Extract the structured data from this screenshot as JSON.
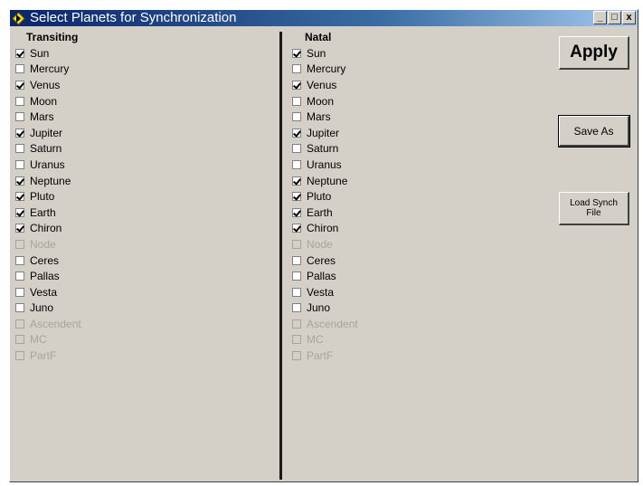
{
  "window": {
    "title": "Select Planets for Synchronization",
    "minimize_glyph": "_",
    "maximize_glyph": "□",
    "close_glyph": "x"
  },
  "transiting": {
    "header": "Transiting",
    "items": [
      {
        "label": "Sun",
        "checked": true,
        "enabled": true
      },
      {
        "label": "Mercury",
        "checked": false,
        "enabled": true
      },
      {
        "label": "Venus",
        "checked": true,
        "enabled": true
      },
      {
        "label": "Moon",
        "checked": false,
        "enabled": true
      },
      {
        "label": "Mars",
        "checked": false,
        "enabled": true
      },
      {
        "label": "Jupiter",
        "checked": true,
        "enabled": true
      },
      {
        "label": "Saturn",
        "checked": false,
        "enabled": true
      },
      {
        "label": "Uranus",
        "checked": false,
        "enabled": true
      },
      {
        "label": "Neptune",
        "checked": true,
        "enabled": true
      },
      {
        "label": "Pluto",
        "checked": true,
        "enabled": true
      },
      {
        "label": "Earth",
        "checked": true,
        "enabled": true
      },
      {
        "label": "Chiron",
        "checked": true,
        "enabled": true
      },
      {
        "label": "Node",
        "checked": false,
        "enabled": false
      },
      {
        "label": "Ceres",
        "checked": false,
        "enabled": true
      },
      {
        "label": "Pallas",
        "checked": false,
        "enabled": true
      },
      {
        "label": "Vesta",
        "checked": false,
        "enabled": true
      },
      {
        "label": "Juno",
        "checked": false,
        "enabled": true
      },
      {
        "label": "Ascendent",
        "checked": false,
        "enabled": false
      },
      {
        "label": "MC",
        "checked": false,
        "enabled": false
      },
      {
        "label": "PartF",
        "checked": false,
        "enabled": false
      }
    ]
  },
  "natal": {
    "header": "Natal",
    "items": [
      {
        "label": "Sun",
        "checked": true,
        "enabled": true
      },
      {
        "label": "Mercury",
        "checked": false,
        "enabled": true
      },
      {
        "label": "Venus",
        "checked": true,
        "enabled": true
      },
      {
        "label": "Moon",
        "checked": false,
        "enabled": true
      },
      {
        "label": "Mars",
        "checked": false,
        "enabled": true
      },
      {
        "label": "Jupiter",
        "checked": true,
        "enabled": true
      },
      {
        "label": "Saturn",
        "checked": false,
        "enabled": true
      },
      {
        "label": "Uranus",
        "checked": false,
        "enabled": true
      },
      {
        "label": "Neptune",
        "checked": true,
        "enabled": true
      },
      {
        "label": "Pluto",
        "checked": true,
        "enabled": true
      },
      {
        "label": "Earth",
        "checked": true,
        "enabled": true
      },
      {
        "label": "Chiron",
        "checked": true,
        "enabled": true
      },
      {
        "label": "Node",
        "checked": false,
        "enabled": false
      },
      {
        "label": "Ceres",
        "checked": false,
        "enabled": true
      },
      {
        "label": "Pallas",
        "checked": false,
        "enabled": true
      },
      {
        "label": "Vesta",
        "checked": false,
        "enabled": true
      },
      {
        "label": "Juno",
        "checked": false,
        "enabled": true
      },
      {
        "label": "Ascendent",
        "checked": false,
        "enabled": false
      },
      {
        "label": "MC",
        "checked": false,
        "enabled": false
      },
      {
        "label": "PartF",
        "checked": false,
        "enabled": false
      }
    ]
  },
  "buttons": {
    "apply": "Apply",
    "save_as": "Save As",
    "load_synch_line1": "Load Synch",
    "load_synch_line2": "File"
  },
  "colors": {
    "face": "#d4d0c8",
    "title_start": "#0a246a",
    "title_end": "#a6caf0",
    "disabled_text": "#a8a49c"
  }
}
